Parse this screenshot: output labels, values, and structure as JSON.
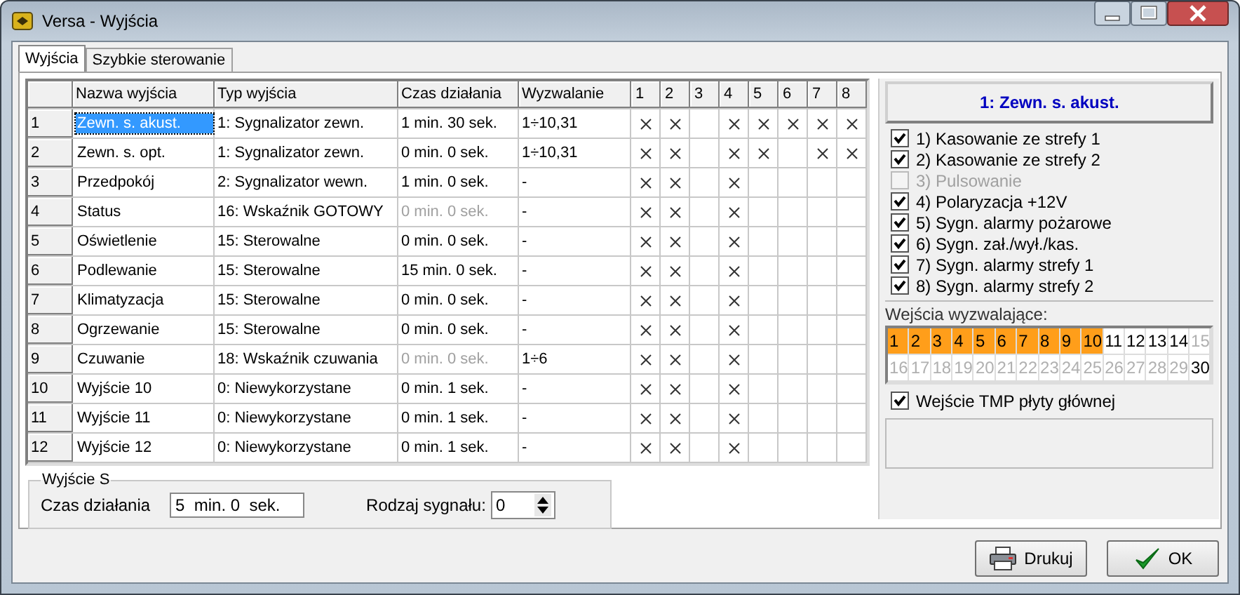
{
  "window": {
    "title": "Versa - Wyjścia"
  },
  "tabs": [
    {
      "label": "Wyjścia",
      "selected": true
    },
    {
      "label": "Szybkie sterowanie",
      "selected": false
    }
  ],
  "table": {
    "columns": [
      "Nazwa wyjścia",
      "Typ wyjścia",
      "Czas działania",
      "Wyzwalanie",
      "1",
      "2",
      "3",
      "4",
      "5",
      "6",
      "7",
      "8"
    ],
    "rows": [
      {
        "num": "1",
        "name": "Zewn. s. akust.",
        "selected": true,
        "type": "1: Sygnalizator zewn.",
        "time": "1 min. 30 sek.",
        "time_disabled": false,
        "trigger": "1÷10,31",
        "flags": [
          true,
          true,
          false,
          true,
          true,
          true,
          true,
          true
        ]
      },
      {
        "num": "2",
        "name": "Zewn. s. opt.",
        "selected": false,
        "type": "1: Sygnalizator zewn.",
        "time": "0 min. 0 sek.",
        "time_disabled": false,
        "trigger": "1÷10,31",
        "flags": [
          true,
          true,
          false,
          true,
          true,
          false,
          true,
          true
        ]
      },
      {
        "num": "3",
        "name": "Przedpokój",
        "selected": false,
        "type": "2: Sygnalizator wewn.",
        "time": "1 min. 0 sek.",
        "time_disabled": false,
        "trigger": "-",
        "flags": [
          true,
          true,
          false,
          true,
          false,
          false,
          false,
          false
        ]
      },
      {
        "num": "4",
        "name": "Status",
        "selected": false,
        "type": "16: Wskaźnik GOTOWY",
        "time": "0 min. 0 sek.",
        "time_disabled": true,
        "trigger": "-",
        "flags": [
          true,
          true,
          false,
          true,
          false,
          false,
          false,
          false
        ]
      },
      {
        "num": "5",
        "name": "Oświetlenie",
        "selected": false,
        "type": "15: Sterowalne",
        "time": "0 min. 0 sek.",
        "time_disabled": false,
        "trigger": "-",
        "flags": [
          true,
          true,
          false,
          true,
          false,
          false,
          false,
          false
        ]
      },
      {
        "num": "6",
        "name": "Podlewanie",
        "selected": false,
        "type": "15: Sterowalne",
        "time": "15 min. 0 sek.",
        "time_disabled": false,
        "trigger": "-",
        "flags": [
          true,
          true,
          false,
          true,
          false,
          false,
          false,
          false
        ]
      },
      {
        "num": "7",
        "name": "Klimatyzacja",
        "selected": false,
        "type": "15: Sterowalne",
        "time": "0 min. 0 sek.",
        "time_disabled": false,
        "trigger": "-",
        "flags": [
          true,
          true,
          false,
          true,
          false,
          false,
          false,
          false
        ]
      },
      {
        "num": "8",
        "name": "Ogrzewanie",
        "selected": false,
        "type": "15: Sterowalne",
        "time": "0 min. 0 sek.",
        "time_disabled": false,
        "trigger": "-",
        "flags": [
          true,
          true,
          false,
          true,
          false,
          false,
          false,
          false
        ]
      },
      {
        "num": "9",
        "name": "Czuwanie",
        "selected": false,
        "type": "18: Wskaźnik czuwania",
        "time": "0 min. 0 sek.",
        "time_disabled": true,
        "trigger": "1÷6",
        "flags": [
          true,
          true,
          false,
          true,
          false,
          false,
          false,
          false
        ]
      },
      {
        "num": "10",
        "name": "Wyjście 10",
        "selected": false,
        "type": "0: Niewykorzystane",
        "time": "0 min. 1 sek.",
        "time_disabled": false,
        "trigger": "-",
        "flags": [
          true,
          true,
          false,
          true,
          false,
          false,
          false,
          false
        ]
      },
      {
        "num": "11",
        "name": "Wyjście 11",
        "selected": false,
        "type": "0: Niewykorzystane",
        "time": "0 min. 1 sek.",
        "time_disabled": false,
        "trigger": "-",
        "flags": [
          true,
          true,
          false,
          true,
          false,
          false,
          false,
          false
        ]
      },
      {
        "num": "12",
        "name": "Wyjście 12",
        "selected": false,
        "type": "0: Niewykorzystane",
        "time": "0 min. 1 sek.",
        "time_disabled": false,
        "trigger": "-",
        "flags": [
          true,
          true,
          false,
          true,
          false,
          false,
          false,
          false
        ]
      }
    ]
  },
  "output_s": {
    "title": "Wyjście S",
    "time_label": "Czas działania",
    "time_value": "5  min. 0  sek.",
    "signal_label": "Rodzaj sygnału:",
    "signal_value": "0"
  },
  "panel": {
    "header": "1: Zewn. s. akust.",
    "options": [
      {
        "label": "1) Kasowanie ze strefy 1",
        "checked": true,
        "disabled": false
      },
      {
        "label": "2) Kasowanie ze strefy 2",
        "checked": true,
        "disabled": false
      },
      {
        "label": "3) Pulsowanie",
        "checked": false,
        "disabled": true
      },
      {
        "label": "4) Polaryzacja +12V",
        "checked": true,
        "disabled": false
      },
      {
        "label": "5) Sygn. alarmy pożarowe",
        "checked": true,
        "disabled": false
      },
      {
        "label": "6) Sygn. zał./wył./kas.",
        "checked": true,
        "disabled": false
      },
      {
        "label": "7) Sygn. alarmy strefy 1",
        "checked": true,
        "disabled": false
      },
      {
        "label": "8) Sygn. alarmy strefy 2",
        "checked": true,
        "disabled": false
      }
    ],
    "inputs_label": "Wejścia wyzwalające:",
    "inputs": [
      {
        "label": "1",
        "selected": true,
        "disabled": false
      },
      {
        "label": "2",
        "selected": true,
        "disabled": false
      },
      {
        "label": "3",
        "selected": true,
        "disabled": false
      },
      {
        "label": "4",
        "selected": true,
        "disabled": false
      },
      {
        "label": "5",
        "selected": true,
        "disabled": false
      },
      {
        "label": "6",
        "selected": true,
        "disabled": false
      },
      {
        "label": "7",
        "selected": true,
        "disabled": false
      },
      {
        "label": "8",
        "selected": true,
        "disabled": false
      },
      {
        "label": "9",
        "selected": true,
        "disabled": false
      },
      {
        "label": "10",
        "selected": true,
        "disabled": false
      },
      {
        "label": "11",
        "selected": false,
        "disabled": false
      },
      {
        "label": "12",
        "selected": false,
        "disabled": false
      },
      {
        "label": "13",
        "selected": false,
        "disabled": false
      },
      {
        "label": "14",
        "selected": false,
        "disabled": false
      },
      {
        "label": "15",
        "selected": false,
        "disabled": true
      },
      {
        "label": "16",
        "selected": false,
        "disabled": true
      },
      {
        "label": "17",
        "selected": false,
        "disabled": true
      },
      {
        "label": "18",
        "selected": false,
        "disabled": true
      },
      {
        "label": "19",
        "selected": false,
        "disabled": true
      },
      {
        "label": "20",
        "selected": false,
        "disabled": true
      },
      {
        "label": "21",
        "selected": false,
        "disabled": true
      },
      {
        "label": "22",
        "selected": false,
        "disabled": true
      },
      {
        "label": "23",
        "selected": false,
        "disabled": true
      },
      {
        "label": "24",
        "selected": false,
        "disabled": true
      },
      {
        "label": "25",
        "selected": false,
        "disabled": true
      },
      {
        "label": "26",
        "selected": false,
        "disabled": true
      },
      {
        "label": "27",
        "selected": false,
        "disabled": true
      },
      {
        "label": "28",
        "selected": false,
        "disabled": true
      },
      {
        "label": "29",
        "selected": false,
        "disabled": true
      },
      {
        "label": "30",
        "selected": false,
        "disabled": false
      }
    ],
    "tmp": {
      "label": "Wejście TMP płyty głównej",
      "checked": true
    }
  },
  "buttons": [
    {
      "kind": "print",
      "label": "Drukuj"
    },
    {
      "kind": "ok",
      "label": "OK"
    }
  ]
}
